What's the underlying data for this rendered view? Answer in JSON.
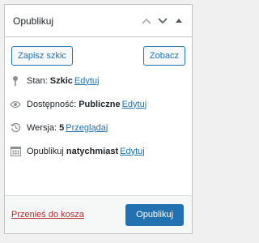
{
  "panel": {
    "title": "Opublikuj"
  },
  "buttons": {
    "save_draft": "Zapisz szkic",
    "preview": "Zobacz"
  },
  "status": {
    "label": "Stan:",
    "value": "Szkic",
    "edit": "Edytuj"
  },
  "visibility": {
    "label": "Dostępność:",
    "value": "Publiczne",
    "edit": "Edytuj"
  },
  "revisions": {
    "label": "Wersja:",
    "value": "5",
    "browse": "Przeglądaj"
  },
  "schedule": {
    "label": "Opublikuj",
    "value": "natychmiast",
    "edit": "Edytuj"
  },
  "footer": {
    "trash": "Przenieś do kosza",
    "publish": "Opublikuj"
  },
  "colors": {
    "accent": "#2271b1",
    "danger": "#b32d2e",
    "border": "#c3c4c7"
  }
}
